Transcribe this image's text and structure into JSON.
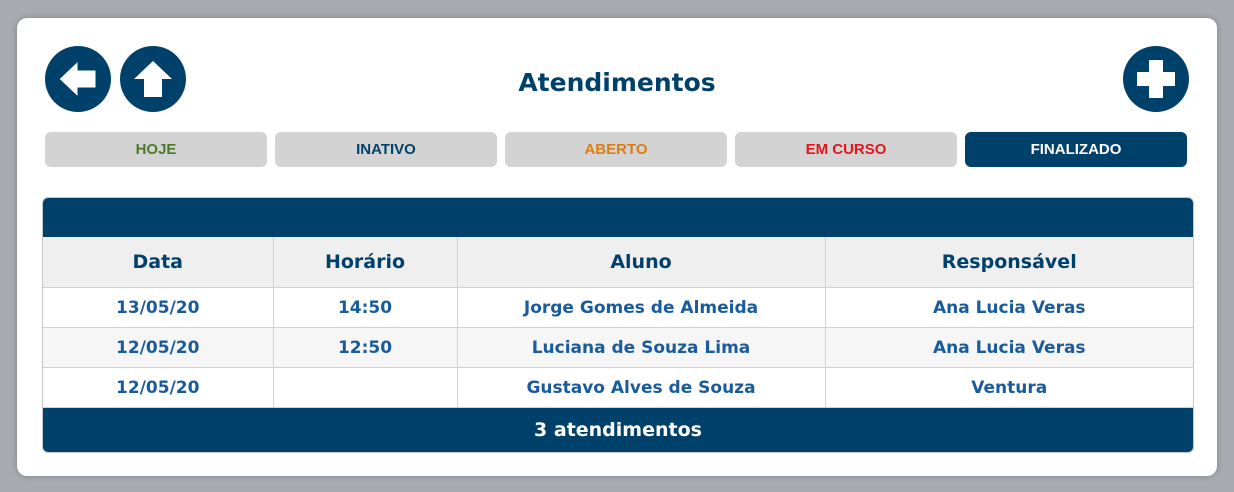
{
  "header": {
    "title": "Atendimentos"
  },
  "tabs": [
    {
      "label": "HOJE",
      "color": "#4a7a2a"
    },
    {
      "label": "INATIVO",
      "color": "#00416b"
    },
    {
      "label": "ABERTO",
      "color": "#e07b13"
    },
    {
      "label": "EM CURSO",
      "color": "#e4151c"
    },
    {
      "label": "FINALIZADO",
      "color": "#ffffff",
      "active": true
    }
  ],
  "table": {
    "columns": [
      "Data",
      "Horário",
      "Aluno",
      "Responsável"
    ],
    "rows": [
      [
        "13/05/20",
        "14:50",
        "Jorge Gomes de Almeida",
        "Ana Lucia Veras"
      ],
      [
        "12/05/20",
        "12:50",
        "Luciana de Souza Lima",
        "Ana Lucia Veras"
      ],
      [
        "12/05/20",
        "",
        "Gustavo Alves de Souza",
        "Ventura"
      ]
    ],
    "footer": "3 atendimentos"
  },
  "icons": {
    "back": "arrow-left-icon",
    "home": "arrow-up-icon",
    "add": "plus-icon"
  },
  "colors": {
    "primary": "#00416b",
    "tab_bg": "#d3d3d3",
    "cell_text": "#1a5b9c"
  }
}
